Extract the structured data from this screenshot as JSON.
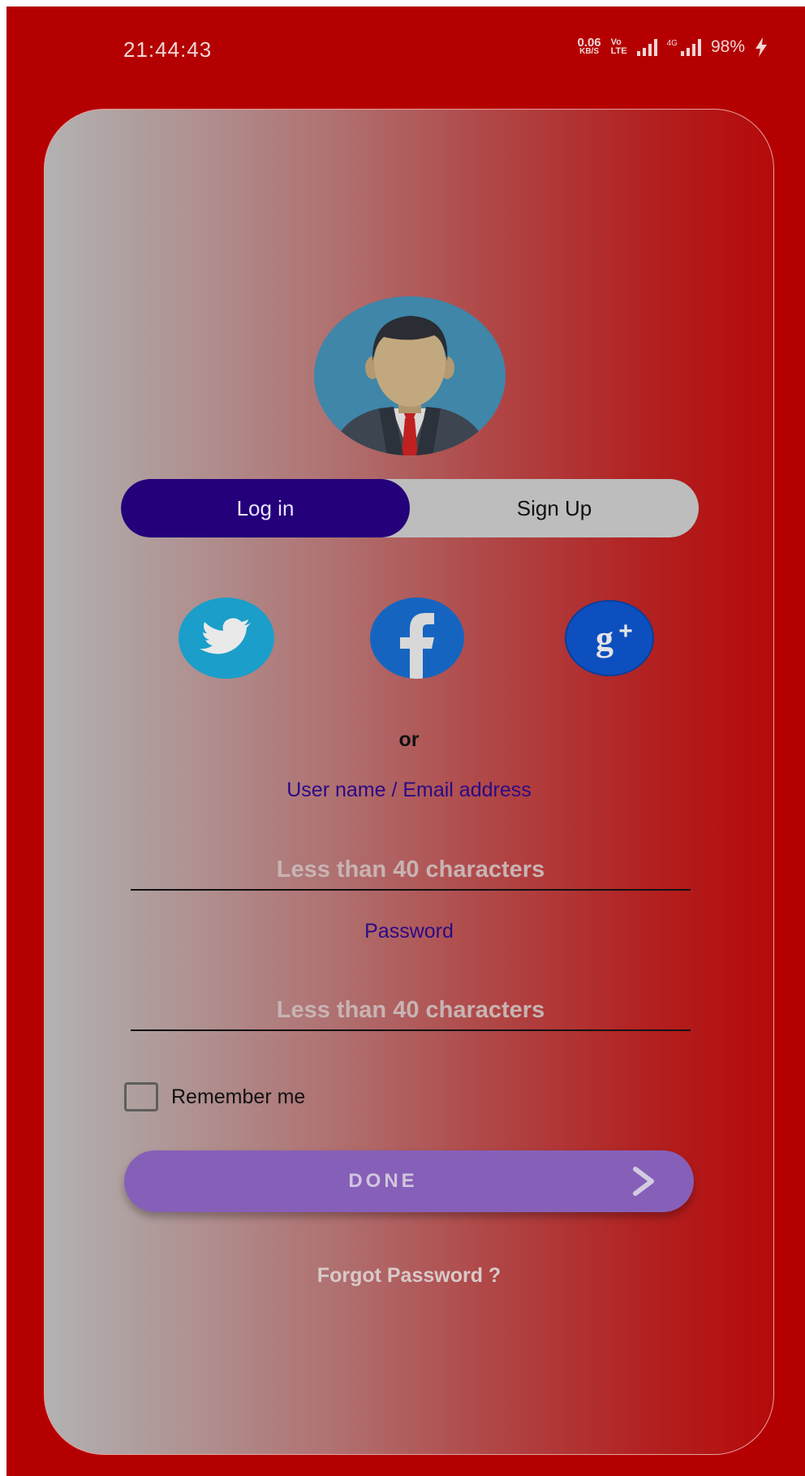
{
  "status_bar": {
    "time": "21:44:43",
    "net_speed_value": "0.06",
    "net_speed_unit": "KB/S",
    "volte_top": "Vo",
    "volte_bottom": "LTE",
    "network_type": "4G",
    "battery": "98%"
  },
  "auth_tabs": {
    "login_label": "Log in",
    "signup_label": "Sign Up",
    "active": "login"
  },
  "social": {
    "twitter_color": "#1b9ec9",
    "facebook_color": "#1565c0",
    "google_plus_color": "#0d4fbf"
  },
  "divider_text": "or",
  "username_field": {
    "label": "User name / Email address",
    "placeholder": "Less than 40 characters",
    "value": ""
  },
  "password_field": {
    "label": "Password",
    "placeholder": "Less than 40 characters",
    "value": ""
  },
  "remember_me": {
    "label": "Remember me",
    "checked": false
  },
  "done_button": {
    "label": "DONE"
  },
  "forgot_password": {
    "label": "Forgot Password ?"
  },
  "colors": {
    "screen_background": "#b40000",
    "active_tab": "#24007a",
    "field_label": "#2a0a86",
    "done_button": "#8660b8"
  }
}
